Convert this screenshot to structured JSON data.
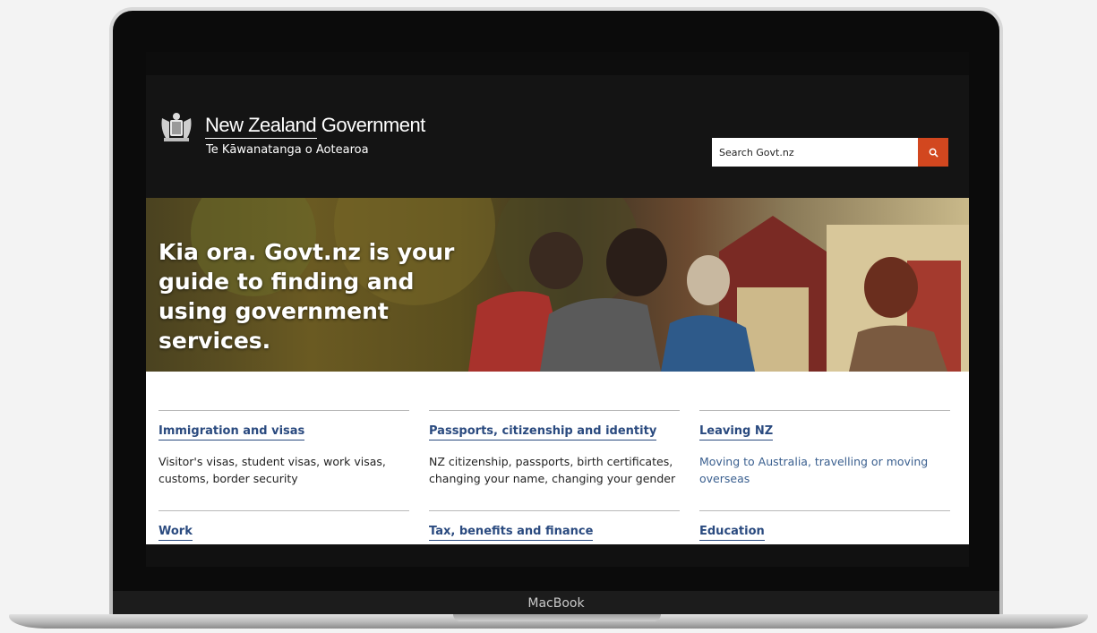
{
  "device": {
    "label": "MacBook"
  },
  "site": {
    "brand_name": "New Zealand Government",
    "brand_subtitle": "Te Kāwanatanga o Aotearoa",
    "search_placeholder": "Search Govt.nz",
    "accent_color": "#d2471f",
    "link_color": "#2a4a7f"
  },
  "hero": {
    "title": "Kia ora. Govt.nz is your guide to finding and using government services."
  },
  "categories": [
    {
      "title": "Immigration and visas",
      "description": "Visitor's visas, student visas, work visas, customs, border security"
    },
    {
      "title": "Passports, citizenship and identity",
      "description": "NZ citizenship, passports, birth certificates, changing your name, changing your gender"
    },
    {
      "title": "Leaving NZ",
      "description": "Moving to Australia, travelling or moving overseas"
    },
    {
      "title": "Work",
      "description": ""
    },
    {
      "title": "Tax, benefits and finance",
      "description": ""
    },
    {
      "title": "Education",
      "description": ""
    }
  ]
}
